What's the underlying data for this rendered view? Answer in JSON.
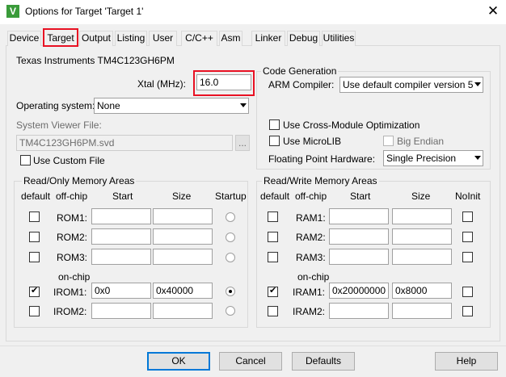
{
  "window": {
    "title": "Options for Target 'Target 1'",
    "app_icon_glyph": "V",
    "close_glyph": "✕"
  },
  "tabs": [
    {
      "label": "Device"
    },
    {
      "label": "Target"
    },
    {
      "label": "Output"
    },
    {
      "label": "Listing"
    },
    {
      "label": "User"
    },
    {
      "label": "C/C++"
    },
    {
      "label": "Asm"
    },
    {
      "label": "Linker"
    },
    {
      "label": "Debug"
    },
    {
      "label": "Utilities"
    }
  ],
  "target": {
    "device_name": "Texas Instruments TM4C123GH6PM",
    "xtal_label": "Xtal (MHz):",
    "xtal_value": "16.0",
    "os_label": "Operating system:",
    "os_value": "None",
    "svd_label": "System Viewer File:",
    "svd_value": "TM4C123GH6PM.svd",
    "browse_label": "...",
    "custom_file_label": "Use Custom File"
  },
  "codegen": {
    "title": "Code Generation",
    "compiler_label": "ARM Compiler:",
    "compiler_value": "Use default compiler version 5",
    "cross_module_label": "Use Cross-Module Optimization",
    "microlib_label": "Use MicroLIB",
    "big_endian_label": "Big Endian",
    "fph_label": "Floating Point Hardware:",
    "fph_value": "Single Precision"
  },
  "rom": {
    "title": "Read/Only Memory Areas",
    "headers": {
      "default": "default",
      "offchip": "off-chip",
      "start": "Start",
      "size": "Size",
      "extra": "Startup"
    },
    "onchip_label": "on-chip",
    "rows": [
      {
        "name": "ROM1:",
        "start": "",
        "size": "",
        "default": false,
        "selected": false
      },
      {
        "name": "ROM2:",
        "start": "",
        "size": "",
        "default": false,
        "selected": false
      },
      {
        "name": "ROM3:",
        "start": "",
        "size": "",
        "default": false,
        "selected": false
      },
      {
        "name": "IROM1:",
        "start": "0x0",
        "size": "0x40000",
        "default": true,
        "selected": true
      },
      {
        "name": "IROM2:",
        "start": "",
        "size": "",
        "default": false,
        "selected": false
      }
    ]
  },
  "ram": {
    "title": "Read/Write Memory Areas",
    "headers": {
      "default": "default",
      "offchip": "off-chip",
      "start": "Start",
      "size": "Size",
      "extra": "NoInit"
    },
    "onchip_label": "on-chip",
    "rows": [
      {
        "name": "RAM1:",
        "start": "",
        "size": "",
        "default": false,
        "noinit": false
      },
      {
        "name": "RAM2:",
        "start": "",
        "size": "",
        "default": false,
        "noinit": false
      },
      {
        "name": "RAM3:",
        "start": "",
        "size": "",
        "default": false,
        "noinit": false
      },
      {
        "name": "IRAM1:",
        "start": "0x20000000",
        "size": "0x8000",
        "default": true,
        "noinit": false
      },
      {
        "name": "IRAM2:",
        "start": "",
        "size": "",
        "default": false,
        "noinit": false
      }
    ]
  },
  "buttons": {
    "ok": "OK",
    "cancel": "Cancel",
    "defaults": "Defaults",
    "help": "Help"
  },
  "colors": {
    "highlight": "#e81123",
    "accent": "#0078d7"
  }
}
